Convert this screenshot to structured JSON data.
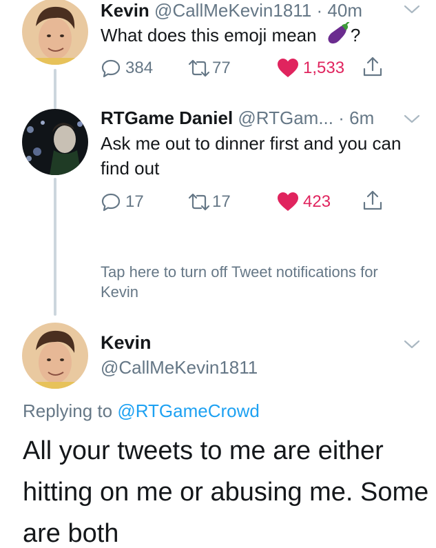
{
  "tweets": [
    {
      "name": "Kevin",
      "handle": "@CallMeKevin1811",
      "time": "· 40m",
      "text_before_emoji": "What does this emoji mean",
      "emoji": "eggplant-emoji",
      "text_after_emoji": "?",
      "replies": "384",
      "retweets": "77",
      "likes": "1,533",
      "liked": true
    },
    {
      "name": "RTGame Daniel",
      "handle": "@RTGam...",
      "time": "· 6m",
      "text": "Ask me out to dinner first and you can find out",
      "replies": "17",
      "retweets": "17",
      "likes": "423",
      "liked": true
    }
  ],
  "notification_prompt": "Tap here to turn off Tweet notifications for Kevin",
  "main_tweet": {
    "name": "Kevin",
    "handle": "@CallMeKevin1811",
    "replying_prefix": "Replying to",
    "replying_to": "@RTGameCrowd",
    "text": "All your tweets to me are either hitting on me or abusing me. Some are both"
  },
  "colors": {
    "accent": "#1da1f2",
    "like": "#e0245e",
    "secondary_text": "#657786",
    "thread_line": "#ccd6dd"
  },
  "icons": [
    "reply-icon",
    "retweet-icon",
    "heart-icon",
    "share-icon",
    "chevron-down-icon",
    "eggplant-emoji"
  ]
}
